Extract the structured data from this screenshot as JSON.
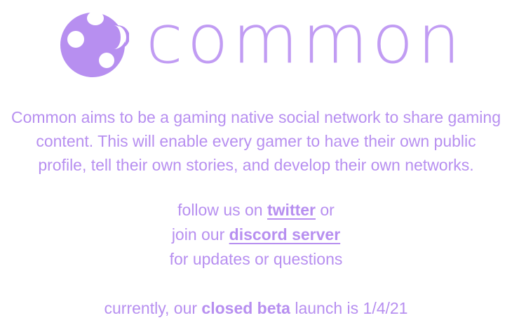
{
  "brand": {
    "name": "common",
    "logo_icon": "common-logo-icon",
    "color": "#b78ff0"
  },
  "about": {
    "line1": "Common aims to be a gaming native social network to share gaming",
    "line2": "content. This will enable every gamer to have their own public",
    "line3": "profile, tell their own stories, and develop their own networks."
  },
  "social": {
    "line1_prefix": "follow us on",
    "twitter_label": "twitter",
    "line1_suffix": "or",
    "line2_prefix": "join our",
    "discord_label": "discord server",
    "line3": "for updates or questions"
  },
  "beta": {
    "prefix": "currently, our",
    "highlight": "closed beta",
    "suffix": "launch is 1/4/21"
  }
}
